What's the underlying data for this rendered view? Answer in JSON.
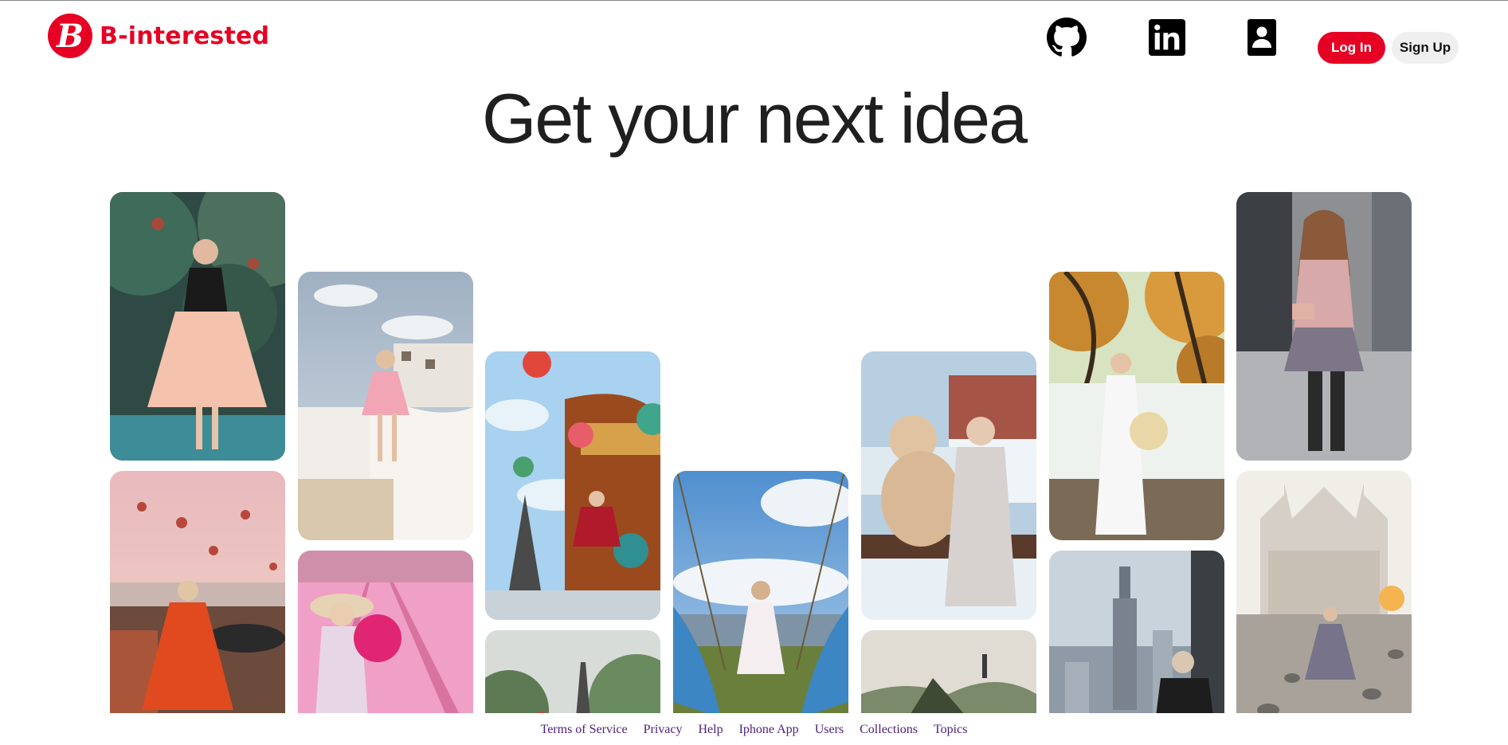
{
  "brand": {
    "badge_letter": "B",
    "name": "B-interested",
    "color": "#e60023"
  },
  "nav": {
    "icons": [
      "github-icon",
      "linkedin-icon",
      "user-profile-icon"
    ],
    "login_label": "Log In",
    "signup_label": "Sign Up"
  },
  "headline": "Get your next idea",
  "pins": [
    {
      "name": "woman-peach-skirt-garden"
    },
    {
      "name": "hot-air-balloons-terrace-red-dress"
    },
    {
      "name": "santorini-pink-dress"
    },
    {
      "name": "tulip-field-hat-bouquet"
    },
    {
      "name": "eiffel-tower-carousel-balloons"
    },
    {
      "name": "pagoda-landscape"
    },
    {
      "name": "swing-wings-sky"
    },
    {
      "name": "teddy-bear-winter-balcony"
    },
    {
      "name": "hill-pagoda-landscape"
    },
    {
      "name": "autumn-lake-white-ao-dai"
    },
    {
      "name": "city-window-skyscraper"
    },
    {
      "name": "street-plaid-skirt-handbag"
    },
    {
      "name": "milan-cathedral-pigeons"
    }
  ],
  "footer": {
    "links": [
      "Terms of Service",
      "Privacy",
      "Help",
      "Iphone App",
      "Users",
      "Collections",
      "Topics"
    ]
  }
}
